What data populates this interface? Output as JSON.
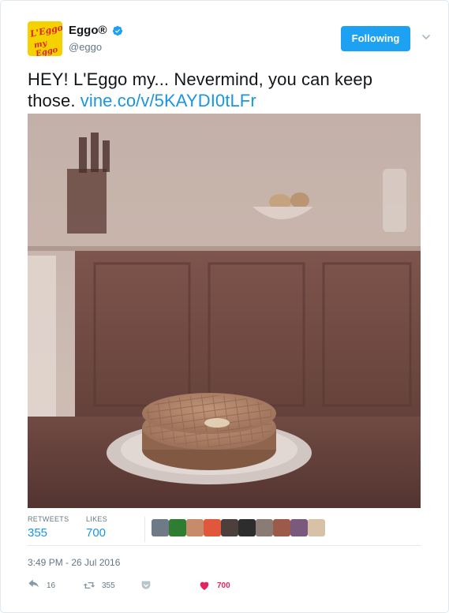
{
  "user": {
    "display_name": "Eggo®",
    "screen_name": "@eggo",
    "avatar_logo_line1": "L'Eggo",
    "avatar_logo_line2": "my Eggo"
  },
  "follow_button": {
    "label": "Following",
    "color": "#1da1f2"
  },
  "tweet": {
    "text": "HEY! L'Eggo my... Nevermind, you can keep those. ",
    "link": "vine.co/v/5KAYDI0tLFr",
    "link_color": "#1b95e0"
  },
  "stats": {
    "retweets_label": "RETWEETS",
    "retweets_value": "355",
    "likes_label": "LIKES",
    "likes_value": "700"
  },
  "liker_avatars": [
    "#6e7b86",
    "#2f7d32",
    "#c58b6a",
    "#e0573b",
    "#4d3f3c",
    "#2d2d2d",
    "#8a7c74",
    "#9b5a4a",
    "#7a5a7c",
    "#d7c2a8"
  ],
  "timestamp": "3:49 PM - 26 Jul 2016",
  "actions": {
    "reply_count": "16",
    "retweet_count": "355",
    "like_count": "700",
    "like_color": "#e0245e"
  }
}
